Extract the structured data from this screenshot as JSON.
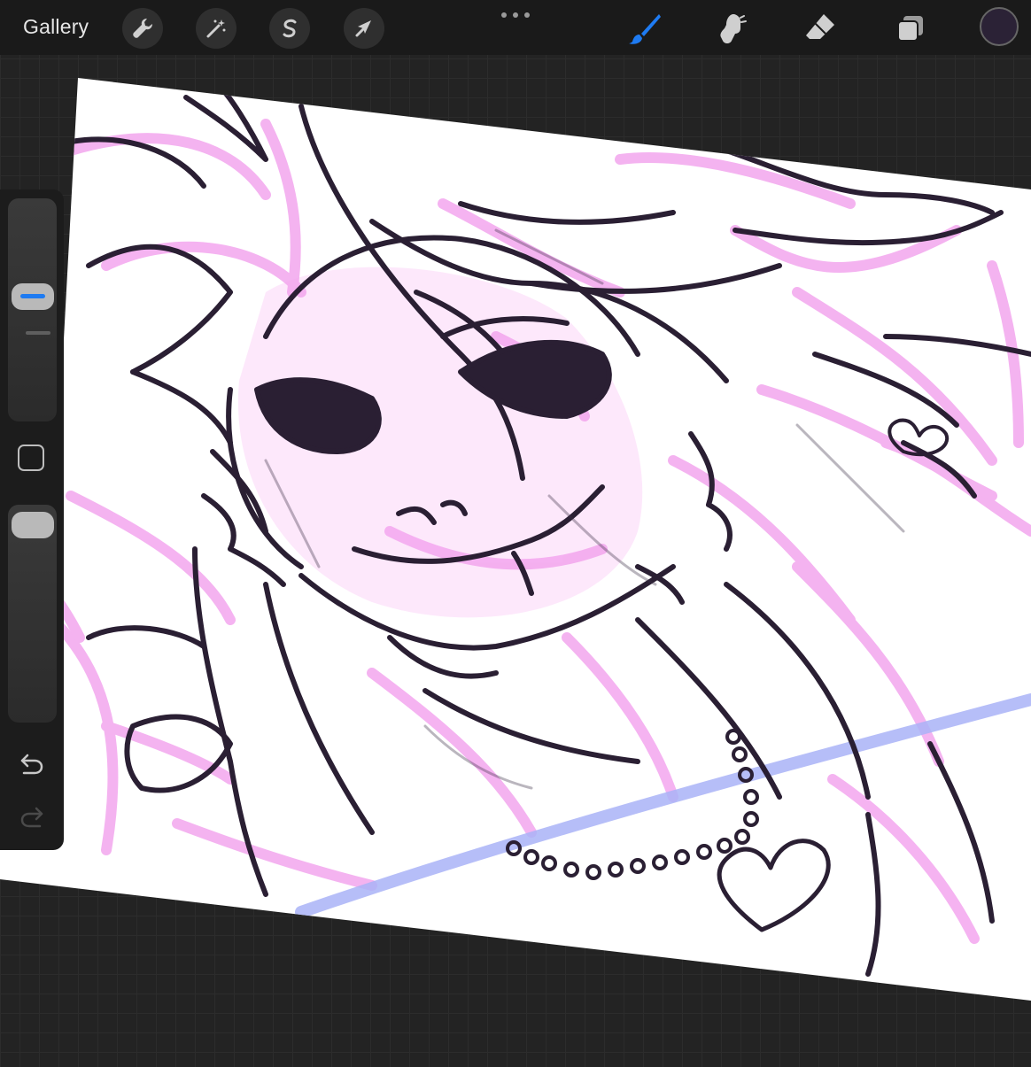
{
  "toolbar": {
    "gallery_label": "Gallery",
    "left_tools": [
      {
        "name": "actions",
        "icon": "wrench-icon"
      },
      {
        "name": "adjustments",
        "icon": "magic-wand-icon"
      },
      {
        "name": "selection",
        "icon": "selection-s-icon"
      },
      {
        "name": "transform",
        "icon": "arrow-cursor-icon"
      }
    ],
    "more_icon": "ellipsis-icon",
    "right_tools": [
      {
        "name": "brush",
        "icon": "brush-icon",
        "active": true
      },
      {
        "name": "smudge",
        "icon": "smudge-icon",
        "active": false
      },
      {
        "name": "eraser",
        "icon": "eraser-icon",
        "active": false
      },
      {
        "name": "layers",
        "icon": "layers-icon",
        "active": false
      }
    ],
    "current_color": "#2b2236",
    "accent_color": "#1e7bf2"
  },
  "sidebar": {
    "brush_size_slider": {
      "icon": "size-slider"
    },
    "modify_button": {
      "icon": "square-icon"
    },
    "opacity_slider": {
      "icon": "opacity-slider"
    },
    "undo": {
      "icon": "undo-icon"
    },
    "redo": {
      "icon": "redo-icon",
      "enabled": false
    }
  },
  "canvas": {
    "colors": {
      "paper": "#ffffff",
      "lineart": "#2a1f33",
      "sketch_pink": "#f3a6ee",
      "sketch_blue": "#a9b3f7",
      "shadow": "#3a2d44"
    }
  }
}
